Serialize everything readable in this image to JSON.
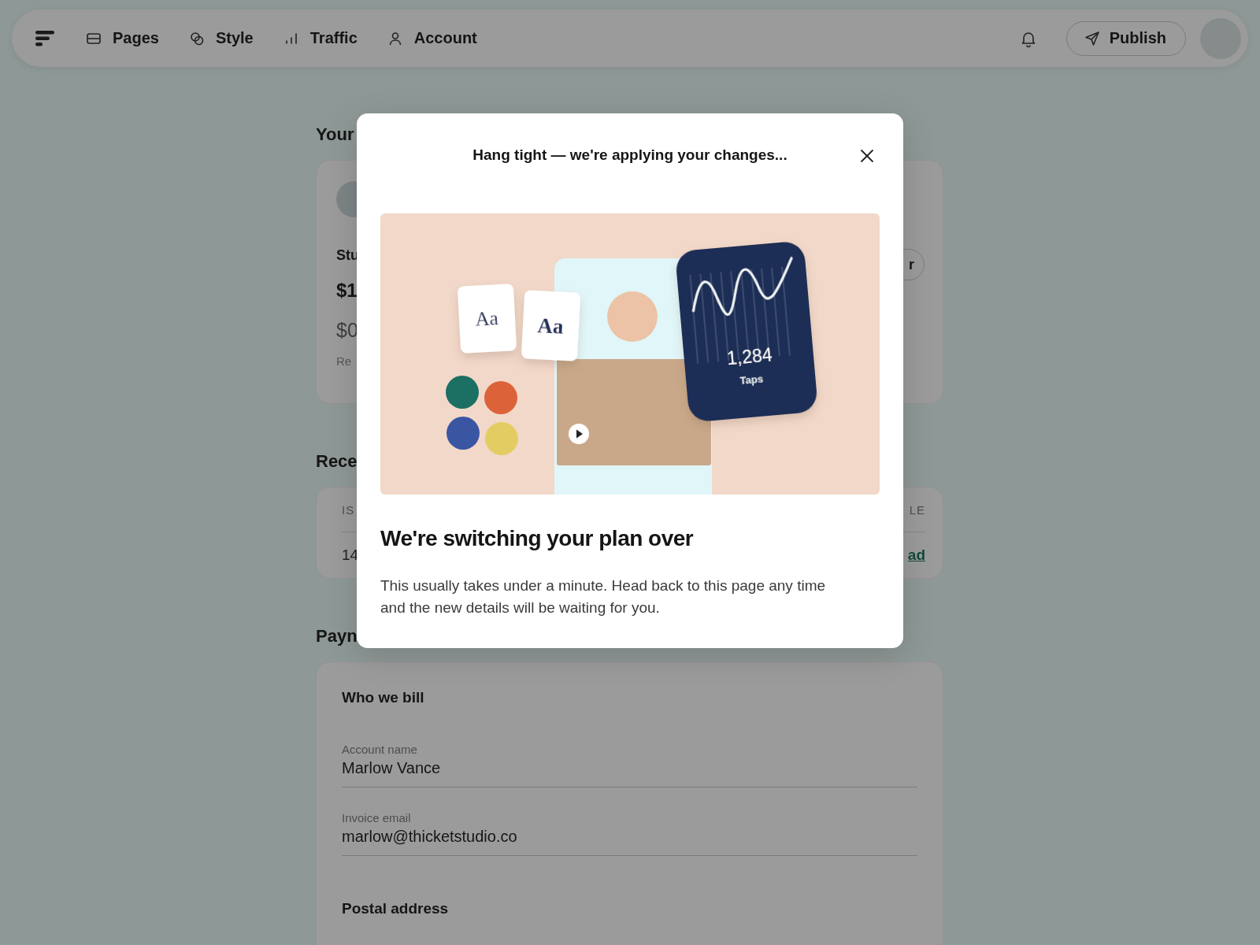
{
  "nav": {
    "items": [
      {
        "label": "Pages"
      },
      {
        "label": "Style"
      },
      {
        "label": "Traffic"
      },
      {
        "label": "Account"
      }
    ],
    "publish": "Publish"
  },
  "page": {
    "plan_heading": "Your",
    "plan_card": {
      "name": "Stu",
      "price": "$1",
      "amount": "$0",
      "note": "Re",
      "button": "r"
    },
    "invoices_heading": "Rece",
    "invoices": {
      "column_1": "IS",
      "column_last": "LE",
      "row_cell": "14",
      "row_link": "ad"
    },
    "payment_heading": "Payn",
    "billing": {
      "section": "Who we bill",
      "fields": [
        {
          "label": "Account name",
          "value": "Marlow Vance"
        },
        {
          "label": "Invoice email",
          "value": "marlow@thicketstudio.co"
        }
      ],
      "next_section": "Postal address"
    }
  },
  "modal": {
    "title": "Hang tight — we're applying your changes...",
    "illustration": {
      "type_samples": [
        "Aa",
        "Aa"
      ],
      "stat_value": "1,284",
      "stat_label": "Taps"
    },
    "heading": "We're switching your plan over",
    "body": "This usually takes under a minute. Head back to this page any time and the new details will be waiting for you."
  }
}
